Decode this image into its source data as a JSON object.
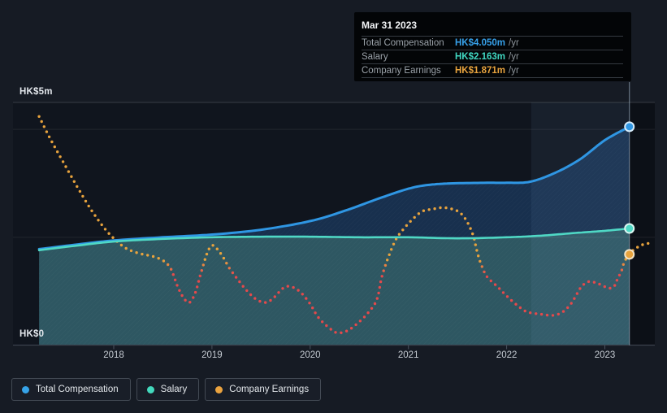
{
  "page": {
    "background": "#161b24"
  },
  "chart_data": {
    "type": "area",
    "title": "",
    "currency": "HK$",
    "y_axis": {
      "top_label": "HK$5m",
      "bottom_label": "HK$0",
      "ylim": [
        0,
        5
      ],
      "unit": "m"
    },
    "x_axis": {
      "tick_labels": [
        "2018",
        "2019",
        "2020",
        "2021",
        "2022",
        "2023"
      ],
      "xlim": [
        2017.23,
        2023.46
      ]
    },
    "grid": "horizontal",
    "legend_position": "bottom-left",
    "highlight_band": {
      "from_year": 2022.25,
      "to_year": 2023.25
    },
    "crosshair_year": 2023.25,
    "series": [
      {
        "name": "Total Compensation",
        "type": "line-area",
        "color": "#2f96e3",
        "fill": "rgba(42,105,180,0.32)",
        "marker_stroke": "#d6ecfb",
        "points": [
          [
            2017.24,
            1.78
          ],
          [
            2017.6,
            1.86
          ],
          [
            2018,
            1.94
          ],
          [
            2018.5,
            2.0
          ],
          [
            2019,
            2.05
          ],
          [
            2019.5,
            2.14
          ],
          [
            2020,
            2.3
          ],
          [
            2020.35,
            2.49
          ],
          [
            2020.7,
            2.72
          ],
          [
            2021,
            2.9
          ],
          [
            2021.2,
            2.97
          ],
          [
            2021.45,
            3.0
          ],
          [
            2021.8,
            3.01
          ],
          [
            2022,
            3.01
          ],
          [
            2022.24,
            3.03
          ],
          [
            2022.5,
            3.2
          ],
          [
            2022.75,
            3.45
          ],
          [
            2023,
            3.8
          ],
          [
            2023.25,
            4.05
          ]
        ]
      },
      {
        "name": "Salary",
        "type": "line-area",
        "color": "#4fd8c5",
        "fill": "rgba(74,148,162,0.52)",
        "marker_stroke": "#dcf7f2",
        "points": [
          [
            2017.24,
            1.76
          ],
          [
            2017.6,
            1.84
          ],
          [
            2018,
            1.92
          ],
          [
            2018.5,
            1.97
          ],
          [
            2019,
            2.0
          ],
          [
            2019.5,
            2.01
          ],
          [
            2020,
            2.01
          ],
          [
            2020.5,
            2.0
          ],
          [
            2021,
            2.0
          ],
          [
            2021.5,
            1.98
          ],
          [
            2022,
            2.0
          ],
          [
            2022.35,
            2.03
          ],
          [
            2022.7,
            2.08
          ],
          [
            2023,
            2.12
          ],
          [
            2023.25,
            2.163
          ]
        ]
      },
      {
        "name": "Company Earnings",
        "type": "dotted-line",
        "color": "#e8a33d",
        "color_low": "#e5494b",
        "low_threshold": 1.3,
        "high_threshold": 1.58,
        "marker_stroke": "#f3e2c4",
        "points": [
          [
            2017.24,
            4.24
          ],
          [
            2017.35,
            3.84
          ],
          [
            2017.49,
            3.38
          ],
          [
            2017.63,
            2.93
          ],
          [
            2017.77,
            2.51
          ],
          [
            2017.9,
            2.18
          ],
          [
            2018,
            1.98
          ],
          [
            2018.12,
            1.8
          ],
          [
            2018.26,
            1.7
          ],
          [
            2018.39,
            1.65
          ],
          [
            2018.5,
            1.57
          ],
          [
            2018.58,
            1.42
          ],
          [
            2018.65,
            1.09
          ],
          [
            2018.71,
            0.88
          ],
          [
            2018.77,
            0.79
          ],
          [
            2018.83,
            0.97
          ],
          [
            2018.89,
            1.35
          ],
          [
            2018.95,
            1.7
          ],
          [
            2019,
            1.85
          ],
          [
            2019.06,
            1.77
          ],
          [
            2019.12,
            1.61
          ],
          [
            2019.18,
            1.42
          ],
          [
            2019.27,
            1.2
          ],
          [
            2019.35,
            1.02
          ],
          [
            2019.45,
            0.85
          ],
          [
            2019.55,
            0.79
          ],
          [
            2019.63,
            0.88
          ],
          [
            2019.72,
            1.05
          ],
          [
            2019.79,
            1.09
          ],
          [
            2019.89,
            1.0
          ],
          [
            2019.99,
            0.79
          ],
          [
            2020.08,
            0.52
          ],
          [
            2020.18,
            0.34
          ],
          [
            2020.27,
            0.23
          ],
          [
            2020.37,
            0.26
          ],
          [
            2020.48,
            0.4
          ],
          [
            2020.59,
            0.6
          ],
          [
            2020.68,
            0.85
          ],
          [
            2020.73,
            1.27
          ],
          [
            2020.8,
            1.65
          ],
          [
            2020.87,
            1.95
          ],
          [
            2020.94,
            2.13
          ],
          [
            2021.04,
            2.33
          ],
          [
            2021.14,
            2.48
          ],
          [
            2021.24,
            2.52
          ],
          [
            2021.35,
            2.55
          ],
          [
            2021.45,
            2.52
          ],
          [
            2021.53,
            2.45
          ],
          [
            2021.6,
            2.28
          ],
          [
            2021.66,
            2.03
          ],
          [
            2021.7,
            1.73
          ],
          [
            2021.74,
            1.5
          ],
          [
            2021.8,
            1.27
          ],
          [
            2021.91,
            1.08
          ],
          [
            2021.99,
            0.93
          ],
          [
            2022.08,
            0.78
          ],
          [
            2022.18,
            0.64
          ],
          [
            2022.24,
            0.6
          ],
          [
            2022.36,
            0.57
          ],
          [
            2022.45,
            0.55
          ],
          [
            2022.52,
            0.57
          ],
          [
            2022.59,
            0.64
          ],
          [
            2022.66,
            0.78
          ],
          [
            2022.71,
            0.93
          ],
          [
            2022.76,
            1.08
          ],
          [
            2022.82,
            1.17
          ],
          [
            2022.88,
            1.17
          ],
          [
            2022.96,
            1.12
          ],
          [
            2023.03,
            1.06
          ],
          [
            2023.09,
            1.08
          ],
          [
            2023.13,
            1.23
          ],
          [
            2023.17,
            1.38
          ],
          [
            2023.2,
            1.55
          ],
          [
            2023.26,
            1.71
          ],
          [
            2023.32,
            1.8
          ],
          [
            2023.38,
            1.86
          ],
          [
            2023.45,
            1.89
          ]
        ]
      }
    ]
  },
  "tooltip": {
    "title": "Mar 31 2023",
    "rows": [
      {
        "label": "Total Compensation",
        "value": "HK$4.050m",
        "unit": "/yr",
        "color": "#37a1ea"
      },
      {
        "label": "Salary",
        "value": "HK$2.163m",
        "unit": "/yr",
        "color": "#41d8c2"
      },
      {
        "label": "Company Earnings",
        "value": "HK$1.871m",
        "unit": "/yr",
        "color": "#e9a43e"
      }
    ]
  },
  "legend": [
    {
      "label": "Total Compensation",
      "color": "#36a3e8"
    },
    {
      "label": "Salary",
      "color": "#43d9bd"
    },
    {
      "label": "Company Earnings",
      "color": "#eba33f"
    }
  ]
}
